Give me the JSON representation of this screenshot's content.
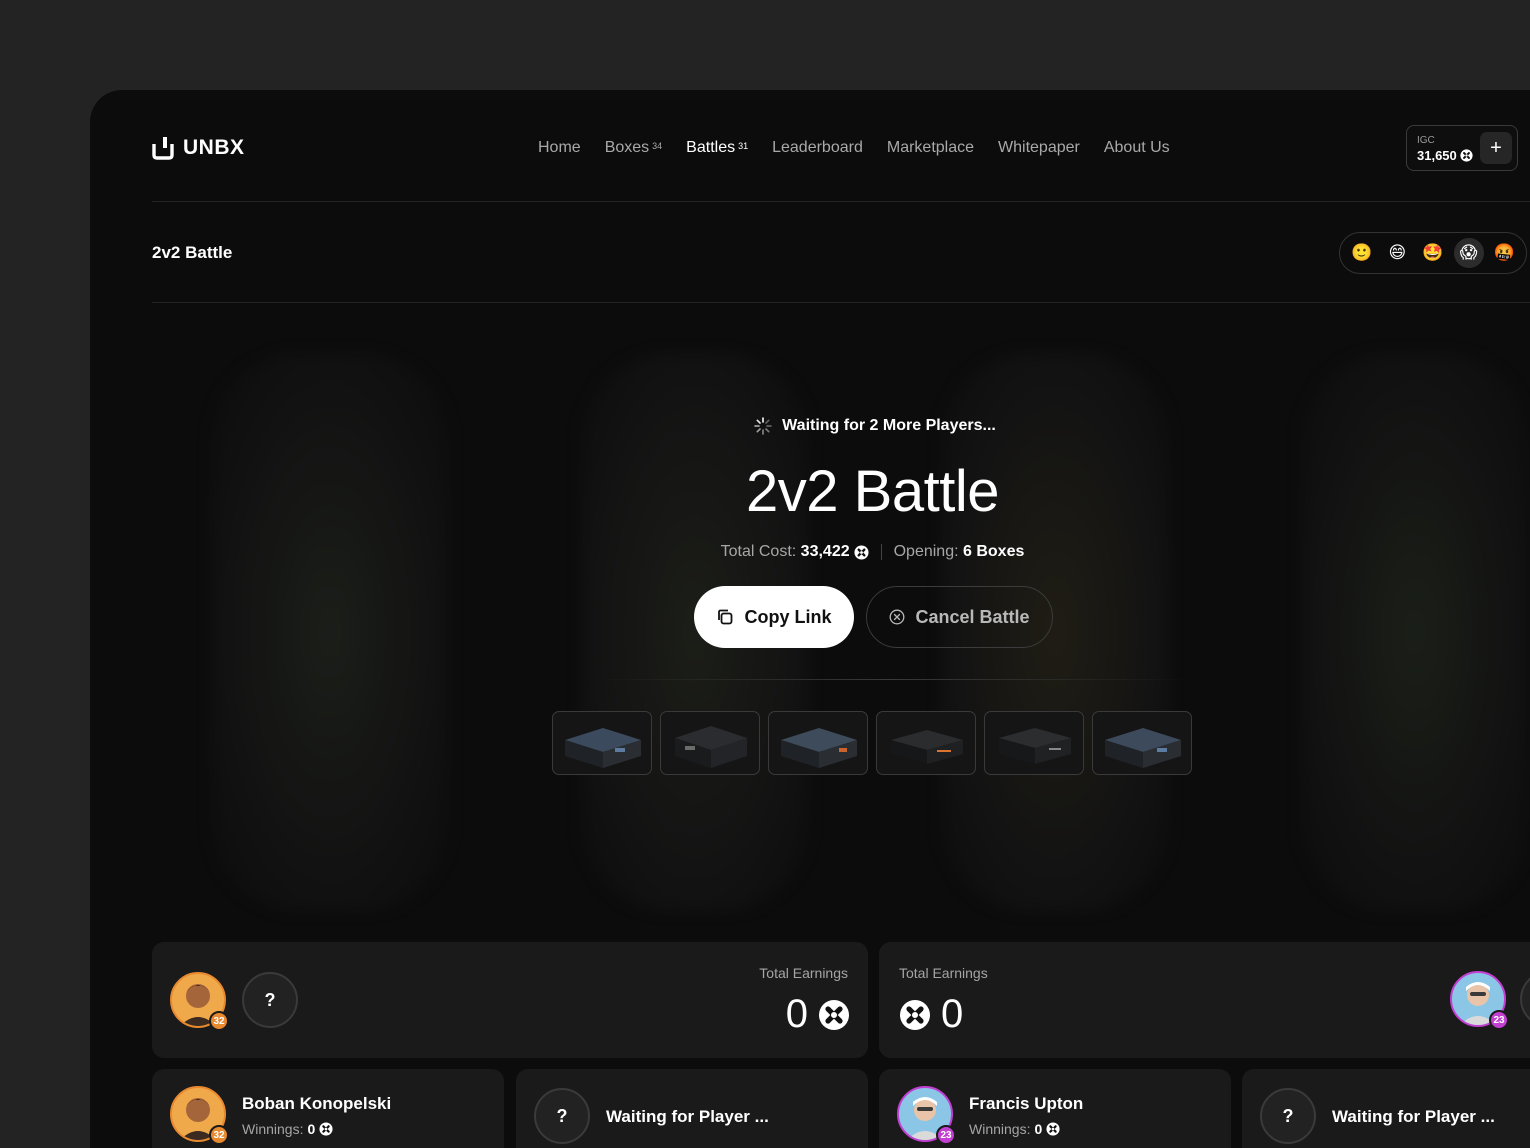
{
  "brand": {
    "name": "UNBX"
  },
  "nav": [
    {
      "label": "Home",
      "badge": ""
    },
    {
      "label": "Boxes",
      "badge": "34"
    },
    {
      "label": "Battles",
      "badge": "31",
      "active": true
    },
    {
      "label": "Leaderboard",
      "badge": ""
    },
    {
      "label": "Marketplace",
      "badge": ""
    },
    {
      "label": "Whitepaper",
      "badge": ""
    },
    {
      "label": "About Us",
      "badge": ""
    }
  ],
  "wallet": {
    "label": "IGC",
    "amount": "31,650",
    "add_label": "+"
  },
  "page": {
    "subtitle": "2v2 Battle"
  },
  "emojis": [
    "🙂",
    "😄",
    "🤩",
    "😱",
    "🤬"
  ],
  "battle": {
    "waiting_text": "Waiting for 2 More Players...",
    "title": "2v2 Battle",
    "total_cost_label": "Total Cost:",
    "total_cost_value": "33,422",
    "opening_label": "Opening:",
    "opening_value": "6 Boxes",
    "copy_label": "Copy Link",
    "cancel_label": "Cancel Battle"
  },
  "boxes": [
    "box-1",
    "box-2",
    "box-3",
    "box-4",
    "box-5",
    "box-6"
  ],
  "teams": [
    {
      "earnings_label": "Total Earnings",
      "earnings_value": "0",
      "avatar_level": "32",
      "slot": "?"
    },
    {
      "earnings_label": "Total Earnings",
      "earnings_value": "0",
      "avatar_level": "23"
    }
  ],
  "players": [
    {
      "name": "Boban Konopelski",
      "winnings_label": "Winnings:",
      "winnings": "0",
      "level": "32"
    },
    {
      "waiting": "Waiting for Player ...",
      "slot": "?"
    },
    {
      "name": "Francis Upton",
      "winnings_label": "Winnings:",
      "winnings": "0",
      "level": "23"
    },
    {
      "waiting": "Waiting for Player ...",
      "slot": "?"
    }
  ],
  "colors": {
    "level_orange": "#e8892f",
    "level_purple": "#c23fd1",
    "background": "#0c0c0c"
  }
}
